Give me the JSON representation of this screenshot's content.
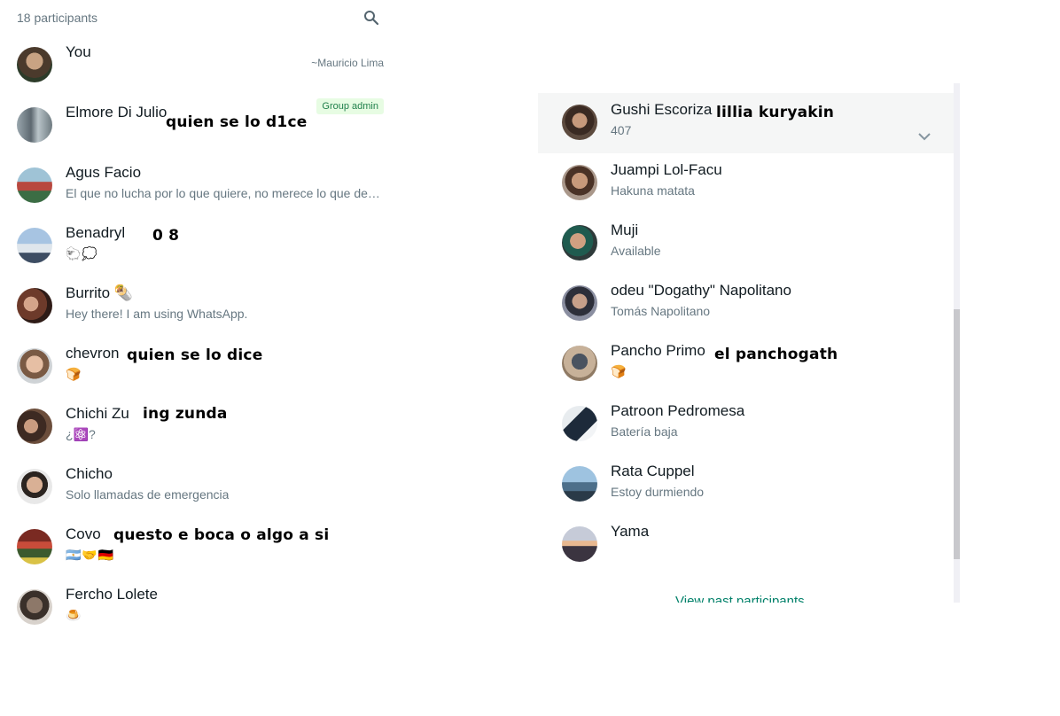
{
  "header": {
    "count": "18 participants"
  },
  "left_list": [
    {
      "name": "You",
      "about": "",
      "pushname": "~Mauricio Lima",
      "badge": "",
      "overlay": ""
    },
    {
      "name": "Elmore Di Julio",
      "about": "",
      "badge": "Group admin",
      "overlay": "quien se lo d1ce"
    },
    {
      "name": "Agus Facio",
      "about": "El que no lucha por lo que quiere, no merece lo que des...",
      "overlay": ""
    },
    {
      "name": "Benadryl",
      "about": "🐑💭",
      "overlay": "0 8"
    },
    {
      "name": "Burrito 🌯",
      "about": "Hey there! I am using WhatsApp.",
      "overlay": ""
    },
    {
      "name": "chevron",
      "about": "🍞",
      "overlay": "quien se lo dice"
    },
    {
      "name": "Chichi Zu",
      "about": "¿⚛️?",
      "overlay": "ing zunda"
    },
    {
      "name": "Chicho",
      "about": "Solo llamadas de emergencia",
      "overlay": ""
    },
    {
      "name": "Covo",
      "about": "🇦🇷🤝🇩🇪",
      "overlay": "questo e boca o algo a si"
    },
    {
      "name": "Fercho Lolete",
      "about": "🍮",
      "overlay": ""
    }
  ],
  "right_list": [
    {
      "name": "Gushi Escoriza",
      "about": "407",
      "overlay": "lillia kuryakin"
    },
    {
      "name": "Juampi Lol-Facu",
      "about": "Hakuna matata",
      "overlay": ""
    },
    {
      "name": "Muji",
      "about": "Available",
      "overlay": ""
    },
    {
      "name": "odeu \"Dogathy\" Napolitano",
      "about": "Tomás Napolitano",
      "overlay": ""
    },
    {
      "name": "Pancho Primo",
      "about": "🍞",
      "overlay": "el panchogath"
    },
    {
      "name": "Patroon Pedromesa",
      "about": "Batería baja",
      "overlay": ""
    },
    {
      "name": "Rata Cuppel",
      "about": "Estoy durmiendo",
      "overlay": ""
    },
    {
      "name": "Yama",
      "about": "",
      "overlay": ""
    }
  ],
  "footer": {
    "view_past": "View past participants"
  },
  "icons": {
    "search": "search-icon",
    "chevron": "chevron-down-icon",
    "avatar": "avatar"
  },
  "colors": {
    "accent": "#008069",
    "muted": "#667781",
    "badge_bg": "#e7fce3"
  }
}
